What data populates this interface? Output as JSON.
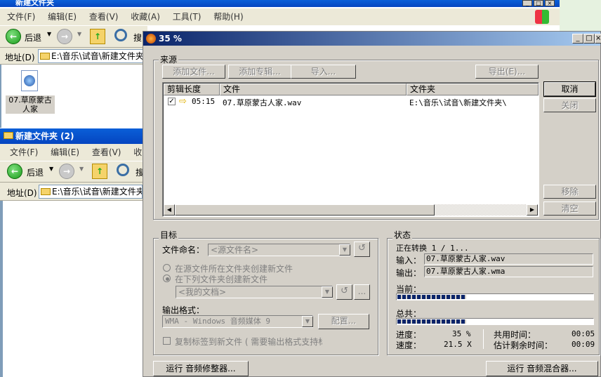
{
  "win1": {
    "title": "新建文件夹",
    "menu": [
      "文件(F)",
      "编辑(E)",
      "查看(V)",
      "收藏(A)",
      "工具(T)",
      "帮助(H)"
    ],
    "back_label": "后退",
    "search_label": "搜",
    "address_label": "地址(D)",
    "address_value": "E:\\音乐\\试音\\新建文件夹",
    "file_name": "07.草原蒙古人家"
  },
  "win2": {
    "title": "新建文件夹 (2)",
    "menu": [
      "文件(F)",
      "编辑(E)",
      "查看(V)",
      "收藏"
    ],
    "back_label": "后退",
    "search_label": "搜",
    "address_label": "地址(D)",
    "address_value": "E:\\音乐\\试音\\新建文件夹"
  },
  "dialog": {
    "title": "35 %",
    "source": {
      "label": "来源",
      "add_file": "添加文件...",
      "add_album": "添加专辑...",
      "import": "导入...",
      "export": "导出(E)...",
      "columns": [
        "剪辑长度",
        "文件",
        "文件夹"
      ],
      "rows": [
        {
          "length": "05:15",
          "file": "07.草原蒙古人家.wav",
          "folder": "E:\\音乐\\试音\\新建文件夹\\"
        }
      ],
      "cancel": "取消",
      "close": "关闭",
      "remove": "移除",
      "clear": "清空"
    },
    "target": {
      "label": "目标",
      "naming_label": "文件命名：",
      "naming_value": "<源文件名>",
      "opt_source": "在源文件所在文件夹创建新文件",
      "opt_folder": "在下列文件夹创建新文件",
      "folder_value": "<我的文档>",
      "format_label": "输出格式：",
      "format_value": "WMA - Windows 音频媒体 9",
      "config": "配置...",
      "copy_tags": "复制标签到新文件 ( 需要输出格式支持标"
    },
    "status": {
      "label": "状态",
      "converting": "正在转换 1 / 1...",
      "input_label": "输入：",
      "input_value": "07.草原蒙古人家.wav",
      "output_label": "输出：",
      "output_value": "07.草原蒙古人家.wma",
      "current_label": "当前：",
      "current_progress": 0.35,
      "total_label": "总共：",
      "total_progress": 0.35,
      "progress_label": "进度：",
      "progress_value": "35 %",
      "speed_label": "速度：",
      "speed_value": "21.5 X",
      "elapsed_label": "共用时间：",
      "elapsed_value": "00:05",
      "remaining_label": "估计剩余时间：",
      "remaining_value": "00:09"
    },
    "run_editor": "运行 音频修整器...",
    "run_mixer": "运行 音频混合器..."
  }
}
